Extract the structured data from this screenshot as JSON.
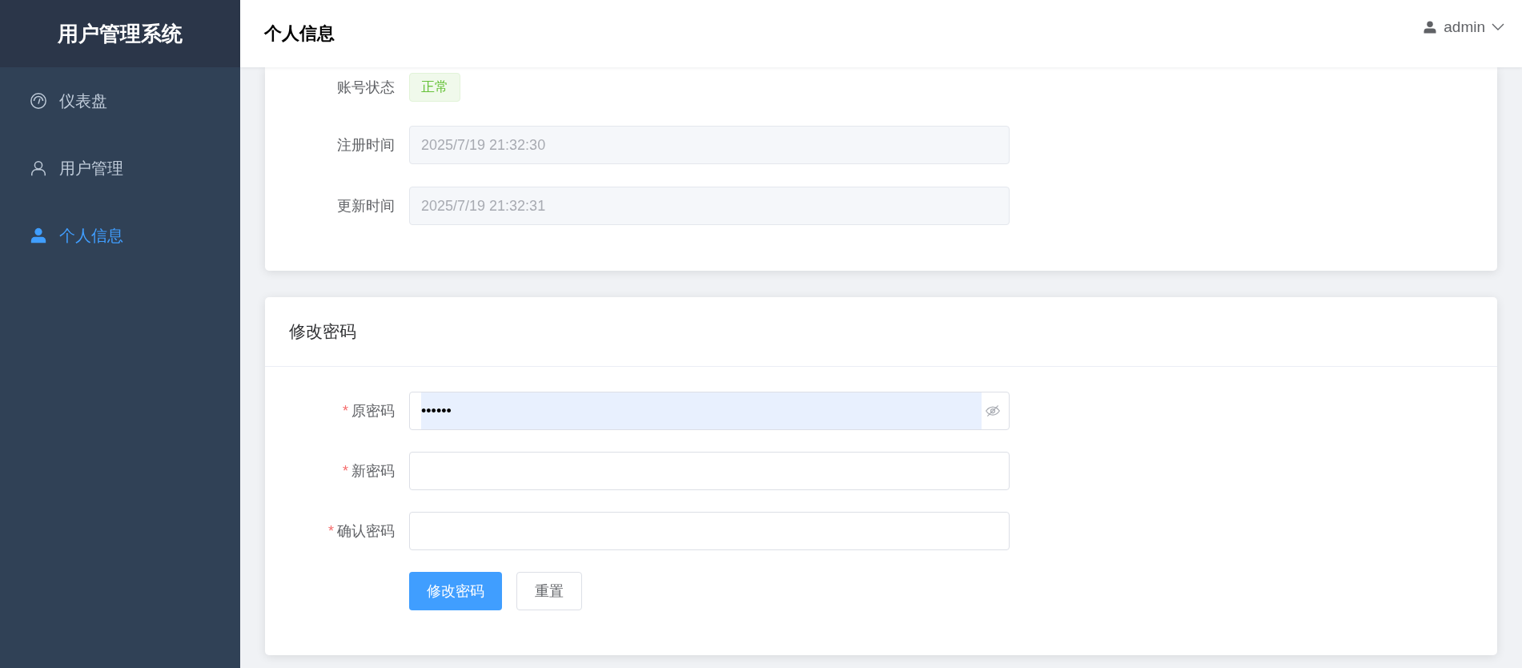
{
  "sidebar": {
    "title": "用户管理系统",
    "items": [
      {
        "label": "仪表盘",
        "kind": "dashboard",
        "selected": false
      },
      {
        "label": "用户管理",
        "kind": "user-outline",
        "selected": false
      },
      {
        "label": "个人信息",
        "kind": "user-filled",
        "selected": true
      }
    ]
  },
  "header": {
    "title": "个人信息",
    "user": "admin"
  },
  "profile_card": {
    "rows": [
      {
        "label": "账号状态",
        "kind": "tag",
        "value": "正常"
      },
      {
        "label": "注册时间",
        "kind": "field",
        "value": "2025/7/19 21:32:30",
        "disabled": true
      },
      {
        "label": "更新时间",
        "kind": "field",
        "value": "2025/7/19 21:32:31",
        "disabled": true
      }
    ]
  },
  "password_card": {
    "title": "修改密码",
    "fields": [
      {
        "label": "原密码",
        "required_mark": "*",
        "value": "••••••",
        "autofilled": true,
        "eye_toggle": true
      },
      {
        "label": "新密码",
        "required_mark": "*",
        "autofilled": false,
        "eye_toggle": false
      },
      {
        "label": "确认密码",
        "required_mark": "*",
        "autofilled": false,
        "eye_toggle": false
      }
    ],
    "buttons": [
      {
        "label": "修改密码",
        "kind": "primary"
      },
      {
        "label": "重置",
        "kind": "default"
      }
    ]
  }
}
